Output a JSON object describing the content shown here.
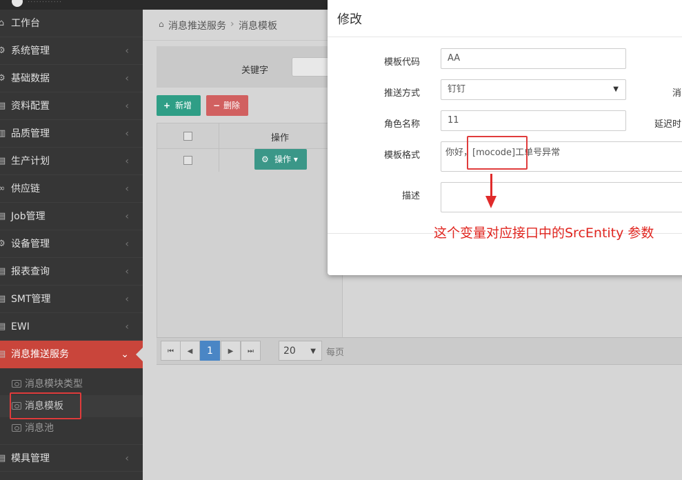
{
  "header": {
    "logo_text": "············"
  },
  "sidebar": {
    "items": [
      {
        "label": "工作台",
        "icon": "home-icon",
        "chevron": ""
      },
      {
        "label": "系统管理",
        "icon": "gear-icon",
        "chevron": "‹"
      },
      {
        "label": "基础数据",
        "icon": "gear-icon",
        "chevron": "‹"
      },
      {
        "label": "资料配置",
        "icon": "list-icon",
        "chevron": "‹"
      },
      {
        "label": "品质管理",
        "icon": "clipboard-icon",
        "chevron": "‹"
      },
      {
        "label": "生产计划",
        "icon": "list-icon",
        "chevron": "‹"
      },
      {
        "label": "供应链",
        "icon": "link-icon",
        "chevron": "‹"
      },
      {
        "label": "Job管理",
        "icon": "list-icon",
        "chevron": "‹"
      },
      {
        "label": "设备管理",
        "icon": "gear-icon",
        "chevron": "‹"
      },
      {
        "label": "报表查询",
        "icon": "list-icon",
        "chevron": "‹"
      },
      {
        "label": "SMT管理",
        "icon": "list-icon",
        "chevron": "‹"
      },
      {
        "label": "EWI",
        "icon": "list-icon",
        "chevron": "‹"
      },
      {
        "label": "消息推送服务",
        "icon": "list-icon",
        "chevron": "⌄"
      }
    ],
    "sub_items": [
      {
        "label": "消息模块类型"
      },
      {
        "label": "消息模板"
      },
      {
        "label": "消息池"
      }
    ],
    "bottom_item": {
      "label": "模具管理",
      "chevron": "‹"
    }
  },
  "breadcrumb": {
    "home_icon": "⌂",
    "parent": "消息推送服务",
    "separator": "›",
    "current": "消息模板"
  },
  "search": {
    "keyword_label": "关键字",
    "keyword_value": ""
  },
  "toolbar": {
    "add_icon": "+",
    "add_label": "新增",
    "delete_icon": "−",
    "delete_label": "删除"
  },
  "grid": {
    "column_operation": "操作",
    "row_action_icon": "⚙",
    "row_action_label": "操作 ▾"
  },
  "pager": {
    "first": "⏮",
    "prev": "◀",
    "current_page": "1",
    "next": "▶",
    "last": "⏭",
    "page_size": "20",
    "page_size_caret": "▼",
    "unit_label": "每页"
  },
  "modal": {
    "title": "修改",
    "fields": {
      "template_code_label": "模板代码",
      "template_code_value": "AA",
      "push_method_label": "推送方式",
      "push_method_value": "钉钉",
      "push_method_caret": "▼",
      "role_name_label": "角色名称",
      "role_name_value": "11",
      "template_format_label": "模板格式",
      "template_format_value": "你好，[mocode]工单号异常",
      "description_label": "描述",
      "description_value": ""
    },
    "right_labels": {
      "msg_partial": "消",
      "delay_partial": "延迟时"
    }
  },
  "annotation": {
    "note": "这个变量对应接口中的SrcEntity 参数",
    "color": "#e0251f"
  },
  "colors": {
    "active_menu": "#c9453b",
    "add_button": "#2f9e86",
    "delete_button": "#d16060",
    "current_page": "#4a86c5"
  }
}
